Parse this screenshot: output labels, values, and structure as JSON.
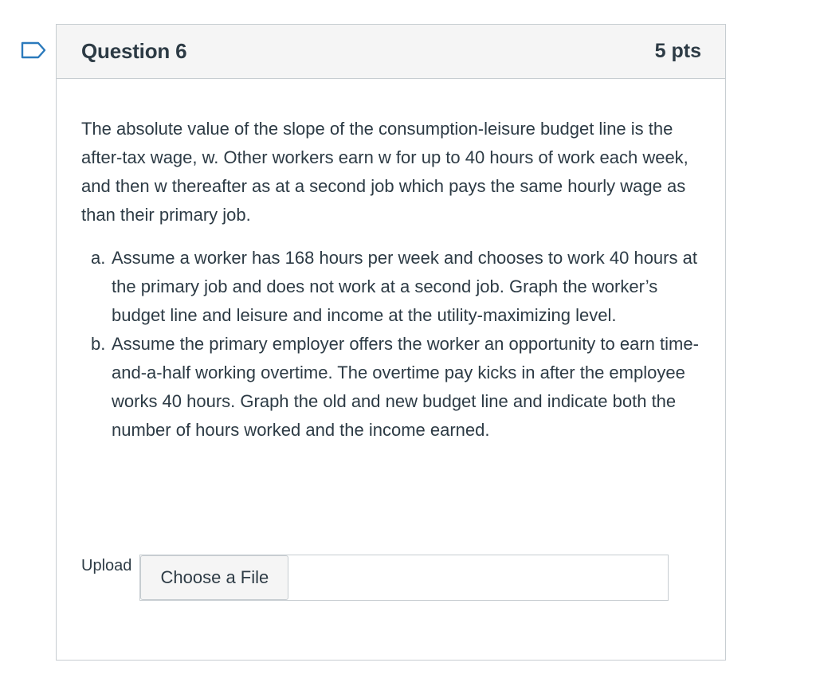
{
  "question": {
    "title": "Question 6",
    "points": "5 pts",
    "intro": "The absolute value of the slope of the consumption-leisure budget line is the after-tax wage, w. Other workers earn w for up to 40 hours of work each week, and then w thereafter as at a second job which pays the same hourly wage as than their primary job.",
    "parts": [
      {
        "marker": "a.",
        "text": "Assume a worker has 168 hours per week and chooses to work 40 hours at the primary job and does not work at a second job. Graph the worker’s budget line and leisure and income at the utility-maximizing level."
      },
      {
        "marker": "b.",
        "text": "Assume the primary employer offers the worker an opportunity to earn time-and-a-half working overtime. The overtime pay kicks in after the employee works 40 hours. Graph the old and new budget line and indicate both the number of hours worked and the income earned."
      }
    ]
  },
  "upload": {
    "label": "Upload",
    "button_label": "Choose a File"
  },
  "icons": {
    "flag": "flag-question-icon"
  },
  "colors": {
    "flag_outline": "#2b7abc",
    "text": "#2d3b45",
    "border": "#c7cdd1",
    "header_bg": "#f5f5f5"
  }
}
